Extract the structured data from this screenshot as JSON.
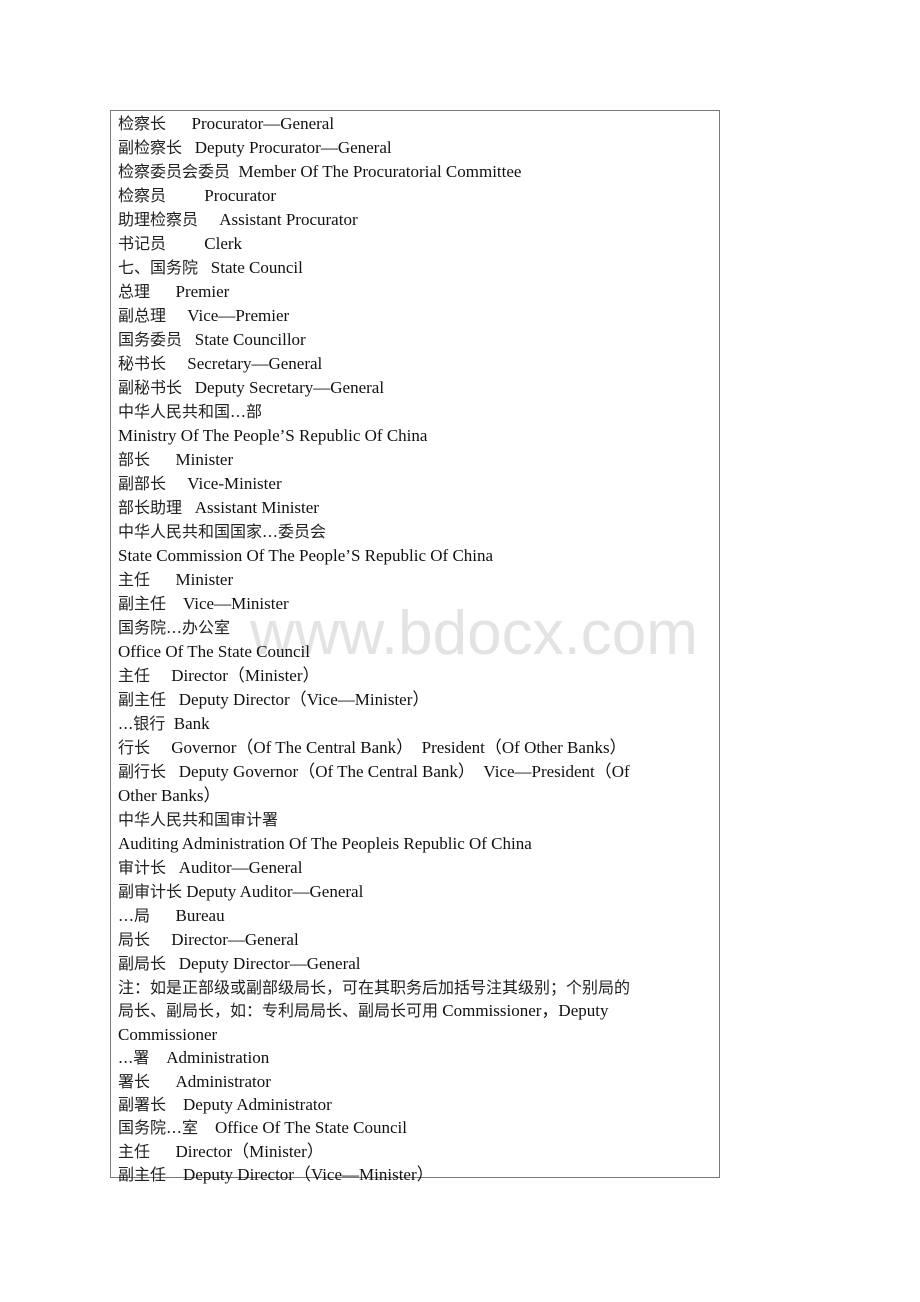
{
  "watermark": "www.bdocx.com",
  "entries": [
    {
      "zh": "检察长",
      "gap": "      ",
      "en": "Procurator—General"
    },
    {
      "zh": "副检察长",
      "gap": "   ",
      "en": "Deputy Procurator—General"
    },
    {
      "zh": "检察委员会委员",
      "gap": "  ",
      "en": "Member Of The Procuratorial Committee"
    },
    {
      "zh": "检察员",
      "gap": "         ",
      "en": "Procurator"
    },
    {
      "zh": "助理检察员",
      "gap": "     ",
      "en": "Assistant Procurator"
    },
    {
      "zh": "书记员",
      "gap": "         ",
      "en": "Clerk"
    },
    {
      "zh": "七、国务院",
      "gap": "   ",
      "en": "State Council"
    },
    {
      "zh": "总理",
      "gap": "      ",
      "en": "Premier"
    },
    {
      "zh": "副总理",
      "gap": "     ",
      "en": "Vice—Premier"
    },
    {
      "zh": "国务委员",
      "gap": "   ",
      "en": "State Councillor"
    },
    {
      "zh": "秘书长",
      "gap": "     ",
      "en": "Secretary—General"
    },
    {
      "zh": "副秘书长",
      "gap": "   ",
      "en": "Deputy Secretary—General"
    },
    {
      "zh": "中华人民共和国…部",
      "gap": "",
      "en": ""
    },
    {
      "zh": "",
      "gap": "",
      "en": "Ministry Of The People’S Republic Of China"
    },
    {
      "zh": "部长",
      "gap": "      ",
      "en": "Minister"
    },
    {
      "zh": "副部长",
      "gap": "     ",
      "en": "Vice-Minister"
    },
    {
      "zh": "部长助理",
      "gap": "   ",
      "en": "Assistant Minister"
    },
    {
      "zh": "中华人民共和国国家…委员会",
      "gap": "",
      "en": ""
    },
    {
      "zh": "",
      "gap": "",
      "en": "State Commission Of The People’S Republic Of China"
    },
    {
      "zh": "主任",
      "gap": "      ",
      "en": "Minister"
    },
    {
      "zh": "副主任",
      "gap": "    ",
      "en": "Vice—Minister"
    },
    {
      "zh": "国务院…办公室",
      "gap": "",
      "en": ""
    },
    {
      "zh": "",
      "gap": "",
      "en": "Office Of The State Council"
    },
    {
      "zh": "主任",
      "gap": "     ",
      "en": "Director（Minister）"
    },
    {
      "zh": "副主任",
      "gap": "   ",
      "en": "Deputy Director（Vice—Minister）"
    },
    {
      "zh": "...银行",
      "gap": "  ",
      "en": "Bank"
    },
    {
      "zh": "行长",
      "gap": "     ",
      "en": "Governor（Of The Central Bank）  President（Of Other Banks）"
    },
    {
      "zh": "副行长",
      "gap": "   ",
      "en": "Deputy Governor（Of The Central Bank）  Vice—President（Of"
    },
    {
      "zh": "",
      "gap": "",
      "en": "Other Banks）"
    },
    {
      "zh": "中华人民共和国审计署",
      "gap": "",
      "en": ""
    },
    {
      "zh": "",
      "gap": "",
      "en": "Auditing Administration Of The Peopleis Republic Of China"
    },
    {
      "zh": "审计长",
      "gap": "   ",
      "en": "Auditor—General"
    },
    {
      "zh": "副审计长",
      "gap": " ",
      "en": "Deputy Auditor—General"
    },
    {
      "zh": "…局",
      "gap": "      ",
      "en": "Bureau"
    },
    {
      "zh": "局长",
      "gap": "     ",
      "en": "Director—General"
    },
    {
      "zh": "副局长",
      "gap": "   ",
      "en": "Deputy Director—General"
    },
    {
      "zh": "注：如是正部级或副部级局长，可在其职务后加括号注其级别；个别局的",
      "gap": "",
      "en": ""
    },
    {
      "zh": "局长、副局长，如：专利局局长、副局长可用",
      "gap": " ",
      "en": "Commissioner，Deputy"
    },
    {
      "zh": "",
      "gap": "",
      "en": "Commissioner"
    },
    {
      "zh": "...署",
      "gap": "    ",
      "en": "Administration"
    },
    {
      "zh": "署长",
      "gap": "      ",
      "en": "Administrator"
    },
    {
      "zh": "副署长",
      "gap": "    ",
      "en": "Deputy Administrator"
    },
    {
      "zh": "国务院…室",
      "gap": "    ",
      "en": "Office Of The State Council"
    },
    {
      "zh": "主任",
      "gap": "      ",
      "en": "Director（Minister）"
    },
    {
      "zh": "副主任",
      "gap": "    ",
      "en": "Deputy Director（Vice—Minister）"
    }
  ]
}
